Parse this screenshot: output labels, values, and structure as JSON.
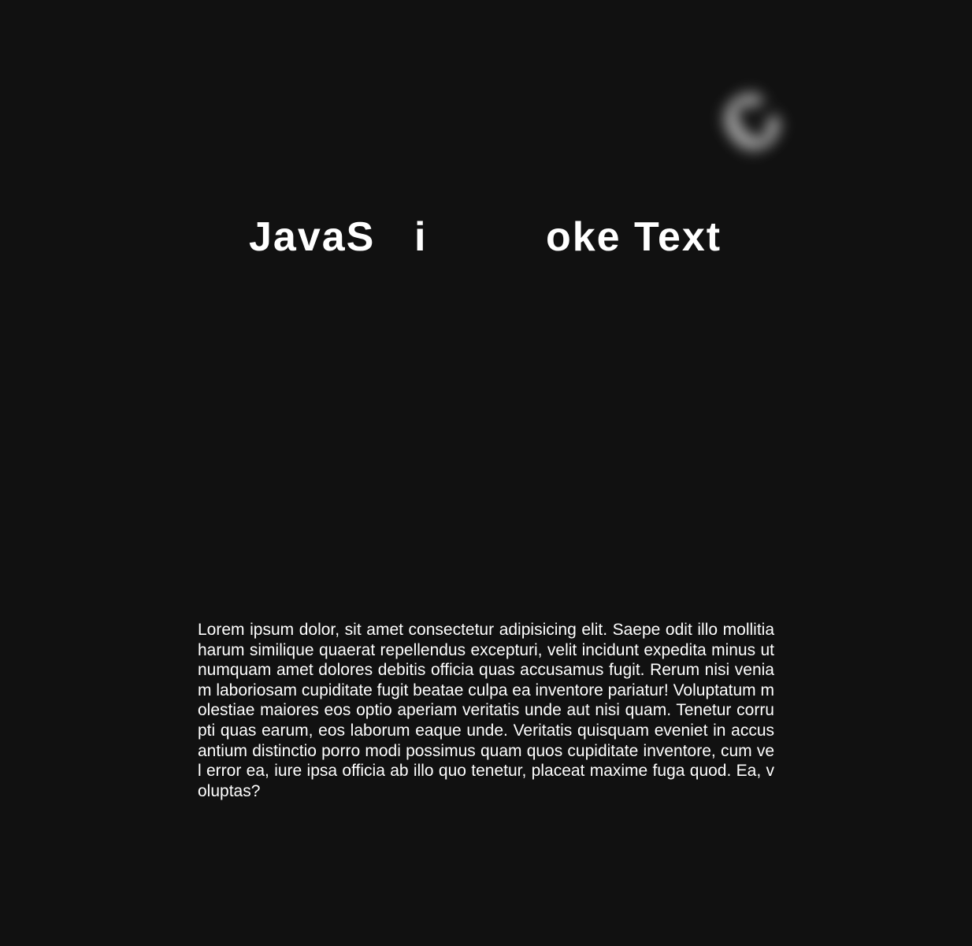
{
  "heading": {
    "part_1": "JavaS",
    "part_2": "i",
    "part_3": "oke Text",
    "smoke_letter": "c"
  },
  "paragraph": {
    "text": "Lorem ipsum dolor, sit amet consectetur adipisicing elit. Saepe odit illo mollitia harum similique quaerat repellendus excepturi, velit incidunt expedita minus ut numquam amet dolores debitis officia quas accusamus fugit. Rerum nisi veniam laboriosam cupiditate fugit beatae culpa ea inventore pariatur! Voluptatum molestiae maiores eos optio aperiam veritatis unde aut nisi quam. Tenetur corrupti quas earum, eos laborum eaque unde. Veritatis quisquam eveniet in accusantium distinctio porro modi possimus quam quos cupiditate inventore, cum vel error ea, iure ipsa officia ab illo quo tenetur, placeat maxime fuga quod. Ea, voluptas?"
  },
  "colors": {
    "background": "#111111",
    "text": "#ffffff",
    "smoke": "#c8c8c8"
  }
}
